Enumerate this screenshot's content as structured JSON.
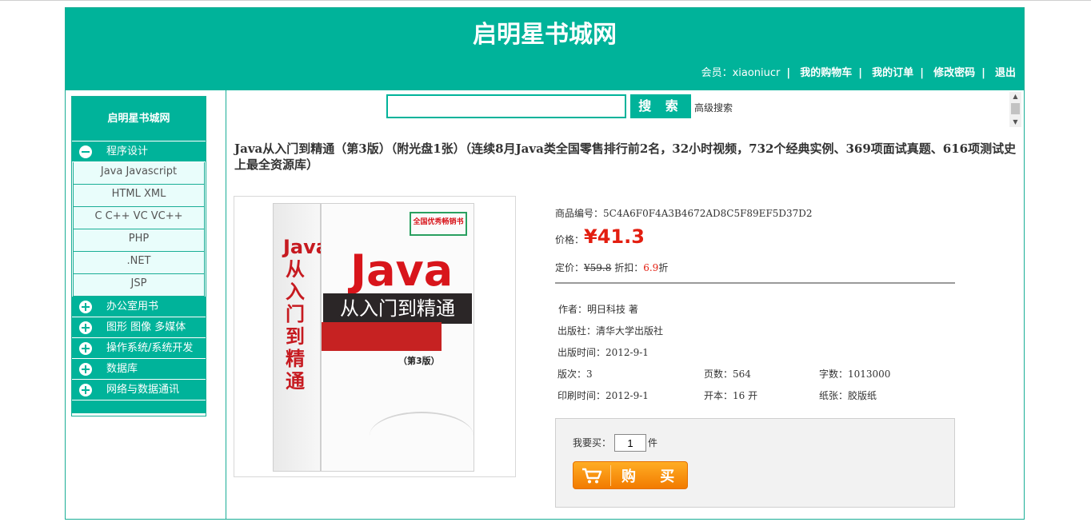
{
  "header": {
    "site_title": "启明星书城网",
    "member_label": "会员：xiaoniucr",
    "links": [
      "我的购物车",
      "我的订单",
      "修改密码",
      "退出"
    ]
  },
  "sidebar": {
    "title": "启明星书城网",
    "categories": [
      {
        "label": "程序设计",
        "expanded": true,
        "subitems": [
          "Java Javascript",
          "HTML XML",
          "C C++ VC VC++",
          "PHP",
          ".NET",
          "JSP"
        ]
      },
      {
        "label": "办公室用书",
        "expanded": false
      },
      {
        "label": "图形 图像 多媒体",
        "expanded": false
      },
      {
        "label": "操作系统/系统开发",
        "expanded": false
      },
      {
        "label": "数据库",
        "expanded": false
      },
      {
        "label": "网络与数据通讯",
        "expanded": false
      }
    ]
  },
  "search": {
    "value": "",
    "button_label": "搜 索",
    "advanced_label": "高级搜索"
  },
  "book": {
    "title": "Java从入门到精通（第3版）（附光盘1张）（连续8月Java类全国零售排行前2名，32小时视频，732个经典实例、369项面试真题、616项测试史上最全资源库）",
    "product_id_label": "商品编号：",
    "product_id": "5C4A6F0F4A3B4672AD8C5F89EF5D37D2",
    "price_label": "价格：",
    "price": "¥41.3",
    "list_price_label": "定价：",
    "list_price": "¥59.8",
    "discount_label": "折扣：",
    "discount": "6.9",
    "discount_suffix": "折",
    "author": "作者：明日科技 著",
    "publisher": "出版社：清华大学出版社",
    "publish_date": "出版时间：2012-9-1",
    "edition": "版次：3",
    "pages": "页数：564",
    "words": "字数：1013000",
    "print_date": "印刷时间：2012-9-1",
    "format": "开本：16 开",
    "paper": "纸张：胶版纸"
  },
  "cover": {
    "word": "Java",
    "subtitle": "从入门到精通",
    "edition": "（第3版）",
    "badge": "全国优秀畅销书",
    "spine": "Java 从入门到精通"
  },
  "purchase": {
    "label": "我要买：",
    "quantity": "1",
    "unit": "件",
    "button_label": "购 买"
  },
  "colors": {
    "primary": "#00b39a",
    "price_red": "#e31e10",
    "buy_orange": "#f27b00"
  }
}
